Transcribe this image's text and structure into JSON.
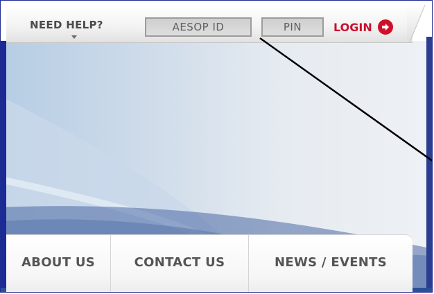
{
  "header": {
    "need_help_label": "NEED HELP?",
    "aesop_id_placeholder": "AESOP ID",
    "pin_placeholder": "PIN",
    "login_label": "LOGIN"
  },
  "nav": {
    "tabs": [
      {
        "label": "ABOUT US"
      },
      {
        "label": "CONTACT US"
      },
      {
        "label": "NEWS / EVENTS"
      }
    ]
  },
  "colors": {
    "login_red": "#c8102e",
    "frame_blue": "#1f2c8f"
  },
  "icons": {
    "login": "right-arrow-circle-icon",
    "help_dropdown": "caret-down-icon"
  }
}
